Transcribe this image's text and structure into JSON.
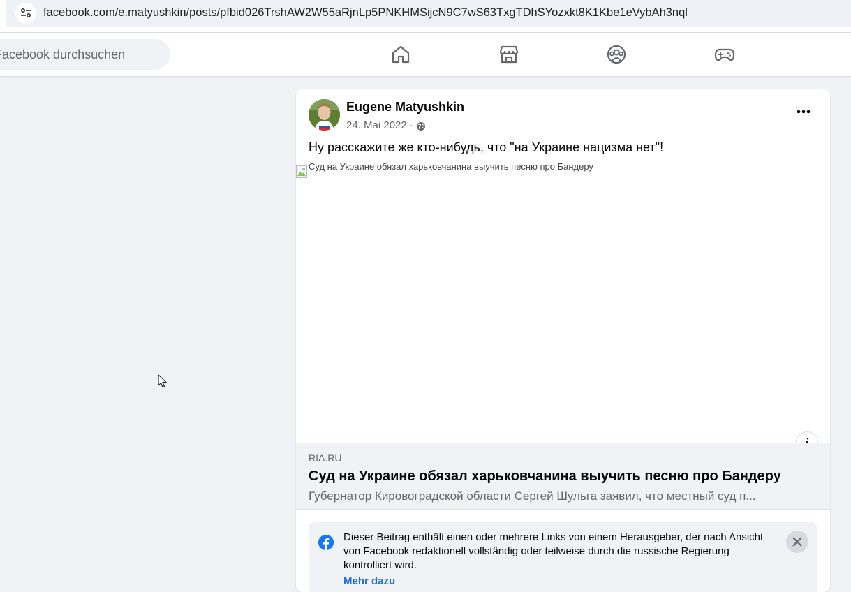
{
  "browser": {
    "url": "facebook.com/e.matyushkin/posts/pfbid026TrshAW2W55aRjnLp5PNKHMSijcN9C7wS63TxgTDhSYozxkt8K1Kbe1eVybAh3nql"
  },
  "nav": {
    "search_placeholder": "Facebook durchsuchen",
    "icons": [
      "home-icon",
      "marketplace-icon",
      "groups-icon",
      "gaming-icon"
    ]
  },
  "post": {
    "author": "Eugene Matyushkin",
    "date": "24. Mai 2022",
    "separator": "·",
    "text": "Ну расскажите же кто-нибудь, что \"на Украине нацизма нет\"!",
    "image_alt": "Суд на Украине обязал харьковчанина выучить песню про Бандеру",
    "info_glyph": "i",
    "link": {
      "domain": "RIA.RU",
      "title": "Суд на Украине обязал харьковчанина выучить песню про Бандеру",
      "description": "Губернатор Кировоградской области Сергей Шульга заявил, что местный суд п..."
    },
    "notice": {
      "text": "Dieser Beitrag enthält einen oder mehrere Links von einem Herausgeber, der nach Ansicht von Facebook redaktionell vollständig oder teilweise durch die russische Regierung kontrolliert wird.",
      "link_label": "Mehr dazu"
    }
  },
  "colors": {
    "accent": "#1877f2",
    "link": "#216fdb",
    "secondary_text": "#65676b",
    "background": "#f0f2f5"
  }
}
